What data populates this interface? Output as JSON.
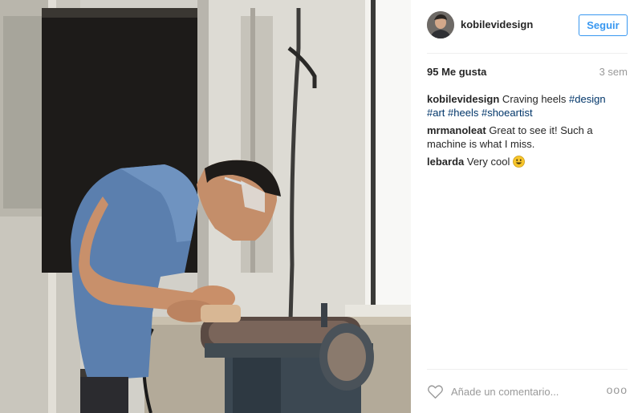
{
  "post": {
    "username": "kobilevidesign",
    "follow_label": "Seguir",
    "likes": "95 Me gusta",
    "time": "3 sem",
    "comments": [
      {
        "user": "kobilevidesign",
        "text": " Craving heels ",
        "tags": [
          "#design",
          "#art",
          "#heels",
          "#shoeartist"
        ]
      },
      {
        "user": "mrmanoleat",
        "text": " Great to see it! Such a machine is what I miss."
      },
      {
        "user": "lebarda",
        "text": " Very cool ",
        "emoji": "grinning-face-icon"
      }
    ],
    "comment_placeholder": "Añade un comentario...",
    "more_label": "ooo"
  },
  "colors": {
    "accent": "#3897f0",
    "hashtag": "#003569",
    "muted": "#999999",
    "shirt": "#5b7fae"
  }
}
